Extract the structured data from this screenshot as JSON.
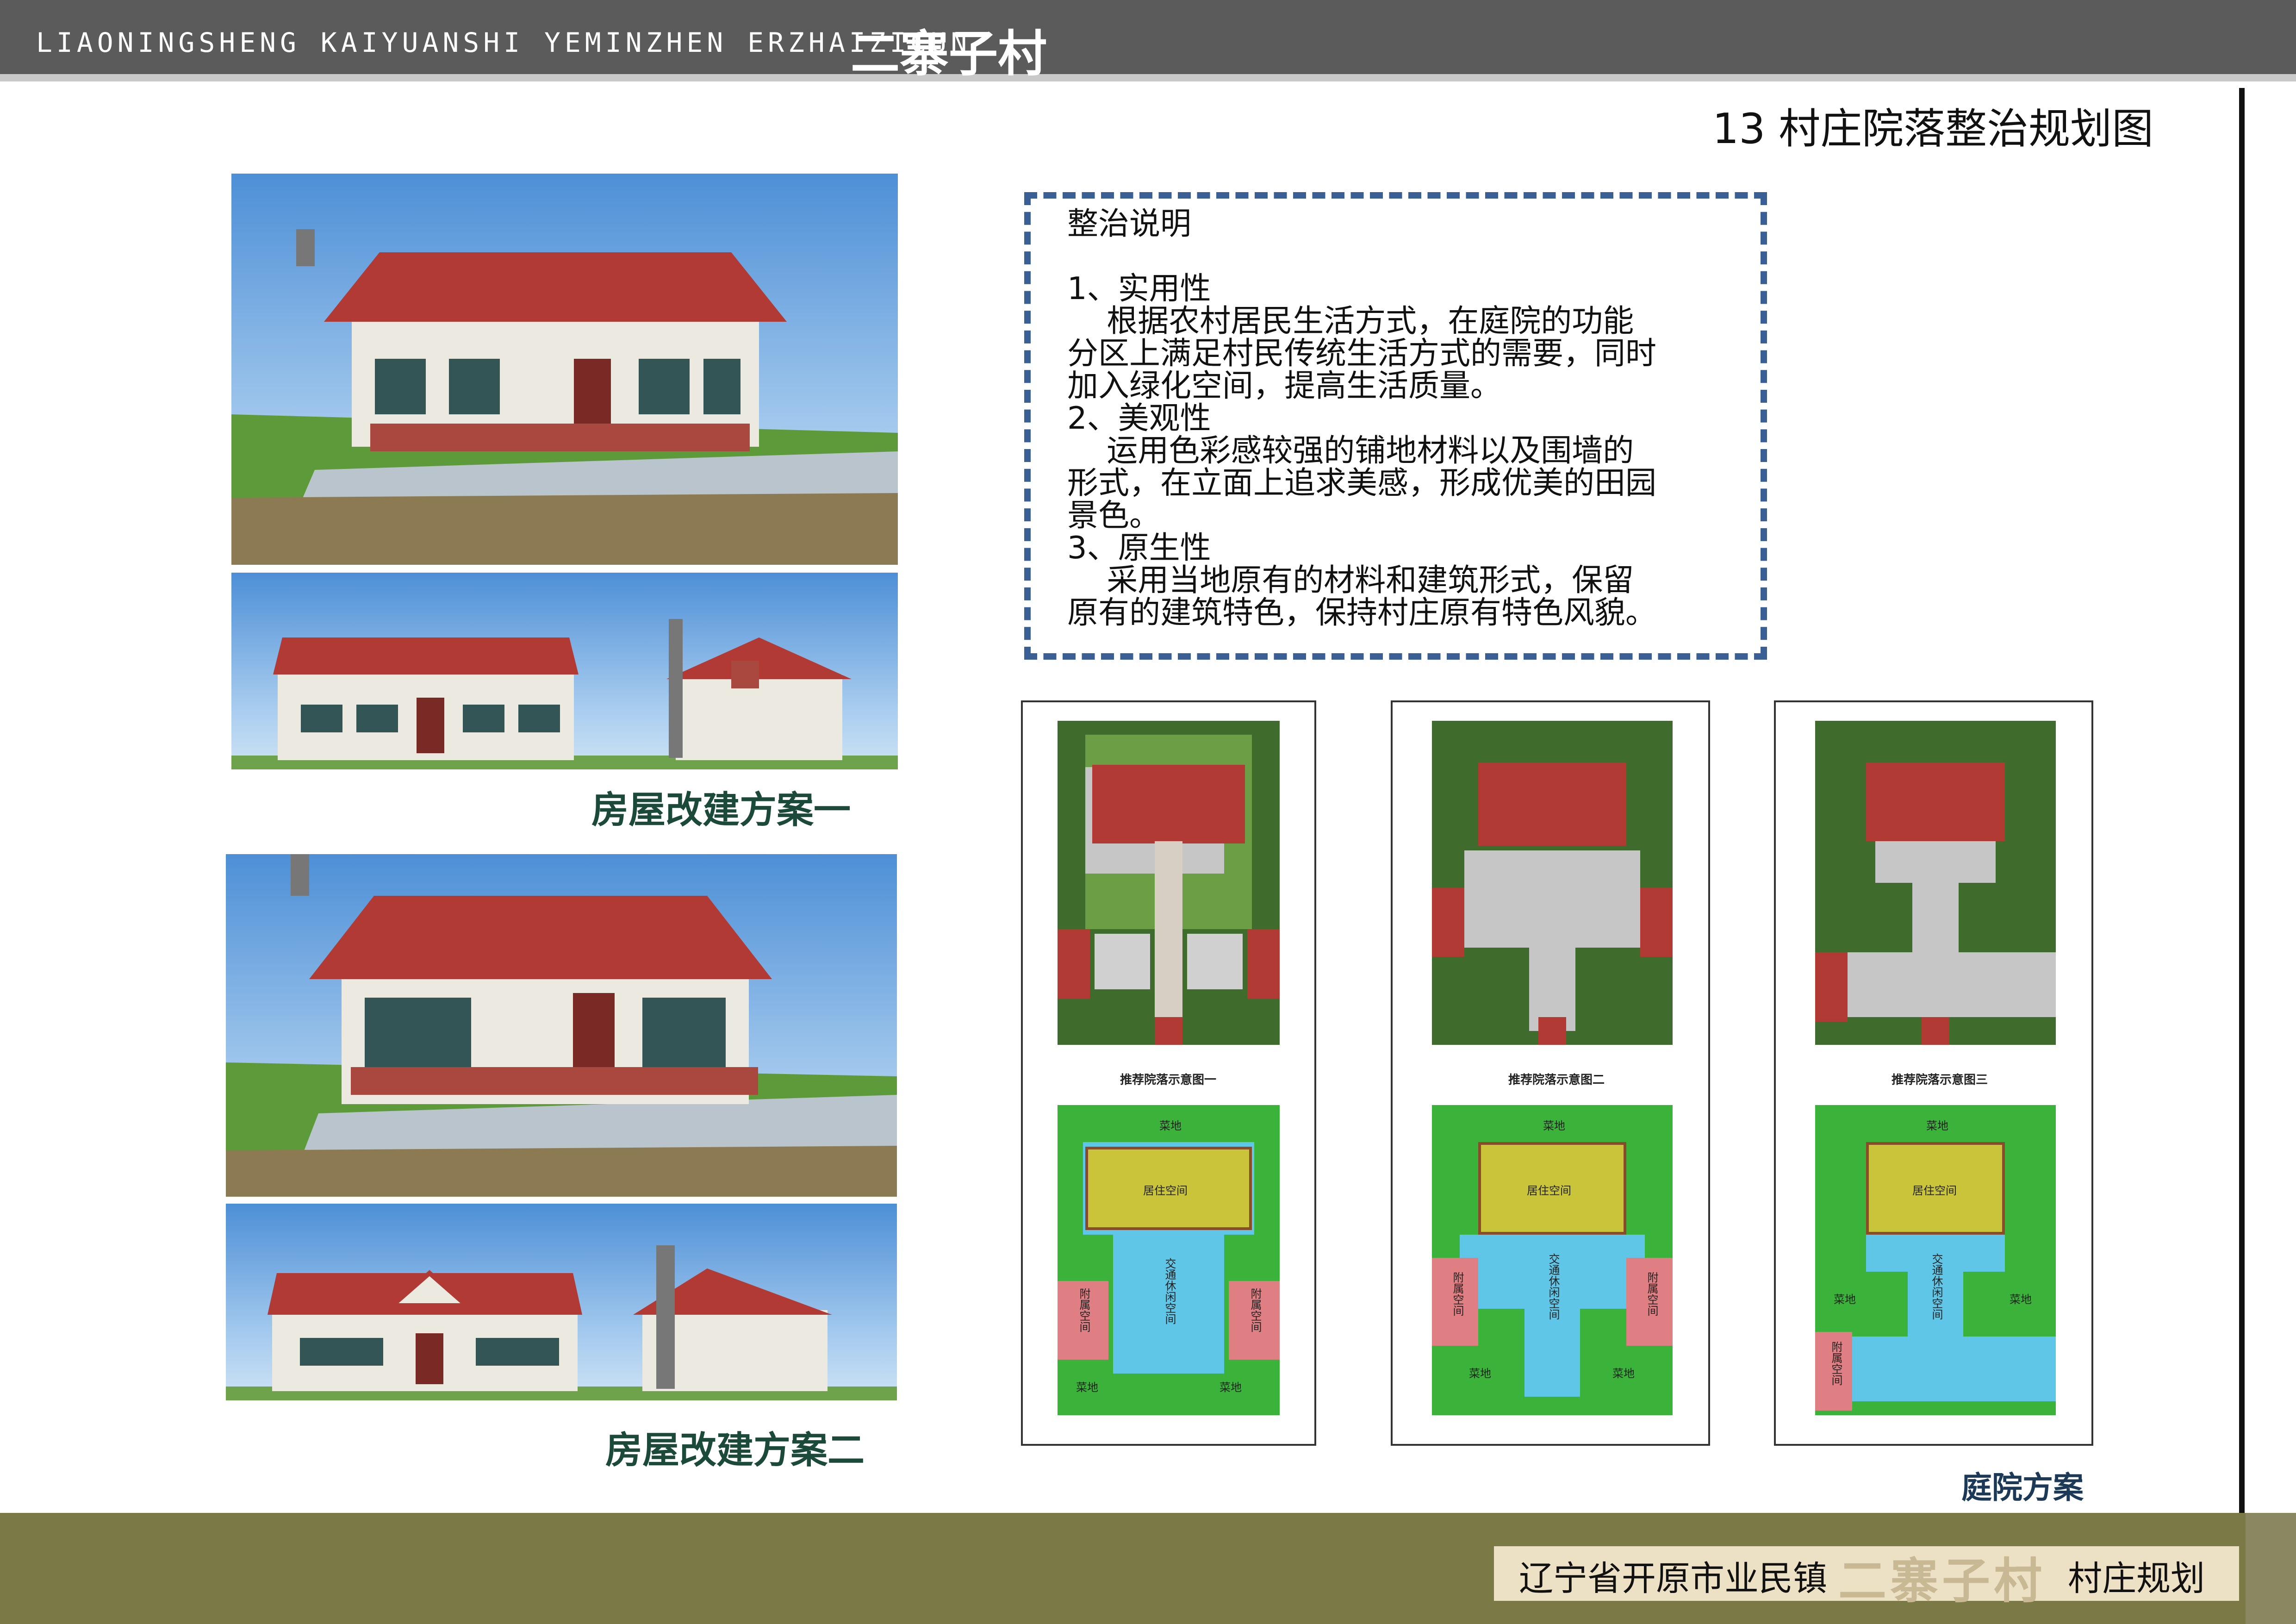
{
  "header": {
    "project_en": "LIAONINGSHENG KAIYUANSHI YEMINZHEN ERZHAIZICUN",
    "project_cn": "二寨子村"
  },
  "page_title": "13 村庄院落整治规划图",
  "footer": {
    "left": "辽宁省开原市业民镇",
    "middle": "二寨子村",
    "right": "村庄规划"
  },
  "schemes": [
    {
      "caption": "房屋改建方案一"
    },
    {
      "caption": "房屋改建方案二"
    }
  ],
  "notes": {
    "title": "整治说明",
    "lines": [
      "1、实用性",
      "    根据农村居民生活方式，在庭院的功能",
      "分区上满足村民传统生活方式的需要，同时",
      "加入绿化空间，提高生活质量。",
      "2、美观性",
      "    运用色彩感较强的铺地材料以及围墙的",
      "形式，在立面上追求美感，形成优美的田园",
      "景色。",
      "3、原生性",
      "    采用当地原有的材料和建筑形式，保留",
      "原有的建筑特色，保持村庄原有特色风貌。"
    ]
  },
  "courtyard_plans": [
    {
      "caption": "推荐院落示意图一",
      "zones": {
        "top": "菜地",
        "living": "居住空间",
        "traffic": "交通休闲空间",
        "side_left": "附属空间",
        "side_right": "附属空间",
        "bottom_left": "菜地",
        "bottom_right": "菜地"
      }
    },
    {
      "caption": "推荐院落示意图二",
      "zones": {
        "top": "菜地",
        "living": "居住空间",
        "traffic": "交通休闲空间",
        "side_left": "附属空间",
        "side_right": "附属空间",
        "bottom_left": "菜地",
        "bottom_right": "菜地"
      }
    },
    {
      "caption": "推荐院落示意图三",
      "zones": {
        "top": "菜地",
        "living": "居住空间",
        "traffic": "交通休闲空间",
        "side_left": "附属空间",
        "mid_left": "菜地",
        "mid_right": "菜地"
      }
    }
  ],
  "courtyard_caption": "庭院方案",
  "colors": {
    "header_bg": "#5b5b5b",
    "footer_bg": "#7b7a47",
    "roof_red": "#b13a35",
    "dashed_border": "#3a5f94",
    "zone_green": "#3bb33b",
    "zone_yellow": "#c9c43a",
    "zone_blue": "#5fc6e8",
    "zone_pink": "#e07f83"
  }
}
